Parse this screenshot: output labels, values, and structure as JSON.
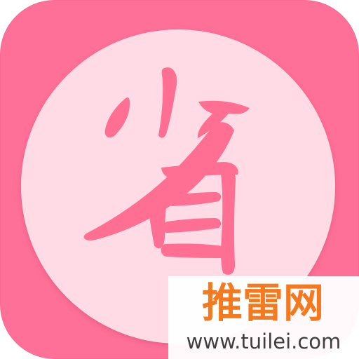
{
  "app_icon": {
    "glyph_text": "省",
    "background_color": "#ff7098",
    "disc_color": "#ffdbe5",
    "glyph_color": "#ff6e93",
    "icon_name": "save-character-icon"
  },
  "watermark": {
    "site_name": "推雷网",
    "url": "www.tuilei.com",
    "title_color": "#f47a20",
    "url_color": "#3e3e3e"
  }
}
